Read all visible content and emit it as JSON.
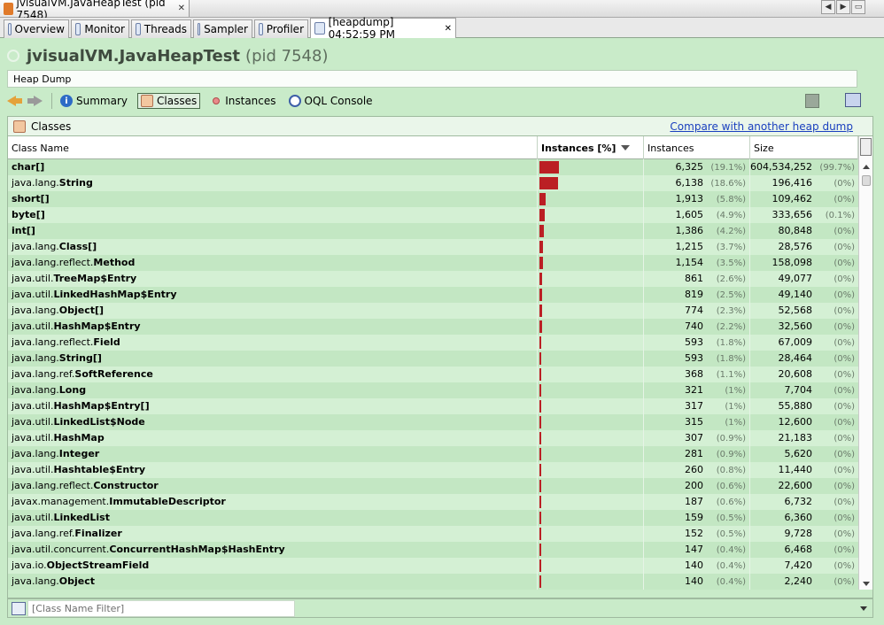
{
  "window": {
    "title": "jvisualVM.JavaHeapTest (pid 7548)",
    "close": "✕"
  },
  "tabs": [
    {
      "label": "Overview",
      "icon": "overview-icon"
    },
    {
      "label": "Monitor",
      "icon": "monitor-icon"
    },
    {
      "label": "Threads",
      "icon": "threads-icon"
    },
    {
      "label": "Sampler",
      "icon": "sampler-icon"
    },
    {
      "label": "Profiler",
      "icon": "profiler-icon"
    },
    {
      "label": "[heapdump] 04:52:59 PM",
      "icon": "heapdump-icon",
      "close": "✕"
    }
  ],
  "app": {
    "title": "jvisualVM.JavaHeapTest",
    "pid": "(pid 7548)"
  },
  "heap_dump_label": "Heap Dump",
  "toolbar": {
    "summary": "Summary",
    "classes": "Classes",
    "instances": "Instances",
    "oql": "OQL Console"
  },
  "panel": {
    "title": "Classes",
    "compare_link": "Compare with another heap dump"
  },
  "columns": {
    "name": "Class Name",
    "instances_pct": "Instances [%]",
    "instances": "Instances",
    "size": "Size"
  },
  "bar_color": "#bb1f24",
  "rows": [
    {
      "pkg": "",
      "cls": "char[]",
      "inst": "6,325",
      "inst_pct": "(19.1%)",
      "inst_frac": 0.191,
      "size": "604,534,252",
      "size_pct": "(99.7%)"
    },
    {
      "pkg": "java.lang.",
      "cls": "String",
      "inst": "6,138",
      "inst_pct": "(18.6%)",
      "inst_frac": 0.186,
      "size": "196,416",
      "size_pct": "(0%)"
    },
    {
      "pkg": "",
      "cls": "short[]",
      "inst": "1,913",
      "inst_pct": "(5.8%)",
      "inst_frac": 0.058,
      "size": "109,462",
      "size_pct": "(0%)"
    },
    {
      "pkg": "",
      "cls": "byte[]",
      "inst": "1,605",
      "inst_pct": "(4.9%)",
      "inst_frac": 0.049,
      "size": "333,656",
      "size_pct": "(0.1%)"
    },
    {
      "pkg": "",
      "cls": "int[]",
      "inst": "1,386",
      "inst_pct": "(4.2%)",
      "inst_frac": 0.042,
      "size": "80,848",
      "size_pct": "(0%)"
    },
    {
      "pkg": "java.lang.",
      "cls": "Class[]",
      "inst": "1,215",
      "inst_pct": "(3.7%)",
      "inst_frac": 0.037,
      "size": "28,576",
      "size_pct": "(0%)"
    },
    {
      "pkg": "java.lang.reflect.",
      "cls": "Method",
      "inst": "1,154",
      "inst_pct": "(3.5%)",
      "inst_frac": 0.035,
      "size": "158,098",
      "size_pct": "(0%)"
    },
    {
      "pkg": "java.util.",
      "cls": "TreeMap$Entry",
      "inst": "861",
      "inst_pct": "(2.6%)",
      "inst_frac": 0.026,
      "size": "49,077",
      "size_pct": "(0%)"
    },
    {
      "pkg": "java.util.",
      "cls": "LinkedHashMap$Entry",
      "inst": "819",
      "inst_pct": "(2.5%)",
      "inst_frac": 0.025,
      "size": "49,140",
      "size_pct": "(0%)"
    },
    {
      "pkg": "java.lang.",
      "cls": "Object[]",
      "inst": "774",
      "inst_pct": "(2.3%)",
      "inst_frac": 0.023,
      "size": "52,568",
      "size_pct": "(0%)"
    },
    {
      "pkg": "java.util.",
      "cls": "HashMap$Entry",
      "inst": "740",
      "inst_pct": "(2.2%)",
      "inst_frac": 0.022,
      "size": "32,560",
      "size_pct": "(0%)"
    },
    {
      "pkg": "java.lang.reflect.",
      "cls": "Field",
      "inst": "593",
      "inst_pct": "(1.8%)",
      "inst_frac": 0.018,
      "size": "67,009",
      "size_pct": "(0%)"
    },
    {
      "pkg": "java.lang.",
      "cls": "String[]",
      "inst": "593",
      "inst_pct": "(1.8%)",
      "inst_frac": 0.018,
      "size": "28,464",
      "size_pct": "(0%)"
    },
    {
      "pkg": "java.lang.ref.",
      "cls": "SoftReference",
      "inst": "368",
      "inst_pct": "(1.1%)",
      "inst_frac": 0.011,
      "size": "20,608",
      "size_pct": "(0%)"
    },
    {
      "pkg": "java.lang.",
      "cls": "Long",
      "inst": "321",
      "inst_pct": "(1%)",
      "inst_frac": 0.01,
      "size": "7,704",
      "size_pct": "(0%)"
    },
    {
      "pkg": "java.util.",
      "cls": "HashMap$Entry[]",
      "inst": "317",
      "inst_pct": "(1%)",
      "inst_frac": 0.01,
      "size": "55,880",
      "size_pct": "(0%)"
    },
    {
      "pkg": "java.util.",
      "cls": "LinkedList$Node",
      "inst": "315",
      "inst_pct": "(1%)",
      "inst_frac": 0.01,
      "size": "12,600",
      "size_pct": "(0%)"
    },
    {
      "pkg": "java.util.",
      "cls": "HashMap",
      "inst": "307",
      "inst_pct": "(0.9%)",
      "inst_frac": 0.009,
      "size": "21,183",
      "size_pct": "(0%)"
    },
    {
      "pkg": "java.lang.",
      "cls": "Integer",
      "inst": "281",
      "inst_pct": "(0.9%)",
      "inst_frac": 0.009,
      "size": "5,620",
      "size_pct": "(0%)"
    },
    {
      "pkg": "java.util.",
      "cls": "Hashtable$Entry",
      "inst": "260",
      "inst_pct": "(0.8%)",
      "inst_frac": 0.008,
      "size": "11,440",
      "size_pct": "(0%)"
    },
    {
      "pkg": "java.lang.reflect.",
      "cls": "Constructor",
      "inst": "200",
      "inst_pct": "(0.6%)",
      "inst_frac": 0.006,
      "size": "22,600",
      "size_pct": "(0%)"
    },
    {
      "pkg": "javax.management.",
      "cls": "ImmutableDescriptor",
      "inst": "187",
      "inst_pct": "(0.6%)",
      "inst_frac": 0.006,
      "size": "6,732",
      "size_pct": "(0%)"
    },
    {
      "pkg": "java.util.",
      "cls": "LinkedList",
      "inst": "159",
      "inst_pct": "(0.5%)",
      "inst_frac": 0.005,
      "size": "6,360",
      "size_pct": "(0%)"
    },
    {
      "pkg": "java.lang.ref.",
      "cls": "Finalizer",
      "inst": "152",
      "inst_pct": "(0.5%)",
      "inst_frac": 0.005,
      "size": "9,728",
      "size_pct": "(0%)"
    },
    {
      "pkg": "java.util.concurrent.",
      "cls": "ConcurrentHashMap$HashEntry",
      "inst": "147",
      "inst_pct": "(0.4%)",
      "inst_frac": 0.004,
      "size": "6,468",
      "size_pct": "(0%)"
    },
    {
      "pkg": "java.io.",
      "cls": "ObjectStreamField",
      "inst": "140",
      "inst_pct": "(0.4%)",
      "inst_frac": 0.004,
      "size": "7,420",
      "size_pct": "(0%)"
    },
    {
      "pkg": "java.lang.",
      "cls": "Object",
      "inst": "140",
      "inst_pct": "(0.4%)",
      "inst_frac": 0.004,
      "size": "2,240",
      "size_pct": "(0%)"
    }
  ],
  "filter": {
    "placeholder": "[Class Name Filter]"
  }
}
